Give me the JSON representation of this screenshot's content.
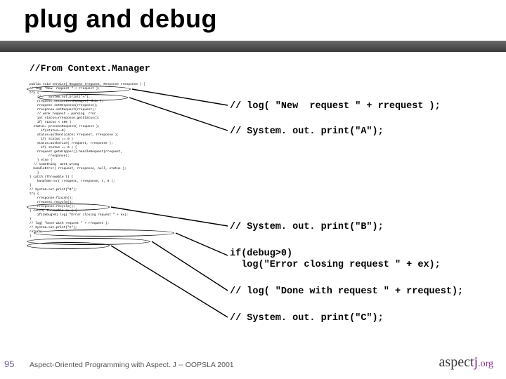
{
  "title": "plug and debug",
  "sourceHeader": "//From Context.Manager",
  "tinyCode": [
    "public void service( Request rrequest, Response rresponse ) {",
    "// log( \"New  request \" + rrequest );",
    "try {",
    "    //    System.out.print(\"A\");",
    "    rrequest.setContextManager( this );",
    "    rrequest.setResponse(rresponse);",
    "    rresponse.setRequest(rrequest);",
    "",
    "    // wrnk request - parsing  rrnr",
    "    int status=rresponse.getStatus();",
    "",
    "",
    "    if( status < 400 )",
    "  status= processRequest( rrequest );",
    "",
    "      if(status==0)",
    "    status=authenticate( rrequest, rresponse );",
    "      if( status == 0 )",
    "    status=authorize( rrequest, rresponse );",
    "      if( status == 0 ) {",
    "    rrequest.getWrapper().handleRequest(rrequest,",
    "          rresponse);",
    "    } else {",
    "  // something  went wrong",
    "  handleError( rrequest, rresponse, null, status );",
    "    }",
    "} catch (Throwable t) {",
    "    handleError( rrequest, rresponse, t, 0 );",
    "}",
    "// System.out.print(\"B\");",
    "try {",
    "    rresponse.finish();",
    "    rrequest.recycle();",
    "    rresponse.recycle();",
    "} catch( Throwable ex ) {",
    "    if(debug>0) log( \"Error closing request \" + ex);",
    "}",
    "// log( \"Done with request \" + rrequest );",
    "// System.out.print(\"C\");",
    "return;",
    "}"
  ],
  "bigLines": {
    "l1": "// log( \"New  request \" + rrequest );",
    "l2": "// System. out. print(\"A\");",
    "l3": "// System. out. print(\"B\");",
    "l4a": "if(debug>0)",
    "l4b": "  log(\"Error closing request \" + ex);",
    "l5": "// log( \"Done with request \" + rrequest);",
    "l6": "// System. out. print(\"C\");"
  },
  "footer": {
    "page": "95",
    "text": "Aspect-Oriented Programming with Aspect. J -- OOPSLA 2001",
    "logo_a": "aspect",
    "logo_j": "j",
    "logo_dot": ".",
    "logo_org": "org"
  }
}
